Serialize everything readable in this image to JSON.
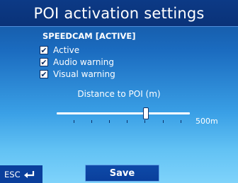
{
  "header": {
    "title": "POI activation settings"
  },
  "section": {
    "title": "SPEEDCAM [ACTIVE]"
  },
  "options": [
    {
      "label": "Active",
      "checked": true
    },
    {
      "label": "Audio warning",
      "checked": true
    },
    {
      "label": "Visual warning",
      "checked": true
    }
  ],
  "distance": {
    "label": "Distance to POI (m)",
    "value_label": "500m",
    "slider_fraction": 0.67
  },
  "footer": {
    "esc_label": "ESC",
    "save_label": "Save"
  },
  "colors": {
    "header_bg": "#0a3278",
    "button_bg": "#0a3f9c",
    "accent_border": "#5fa2e6"
  }
}
